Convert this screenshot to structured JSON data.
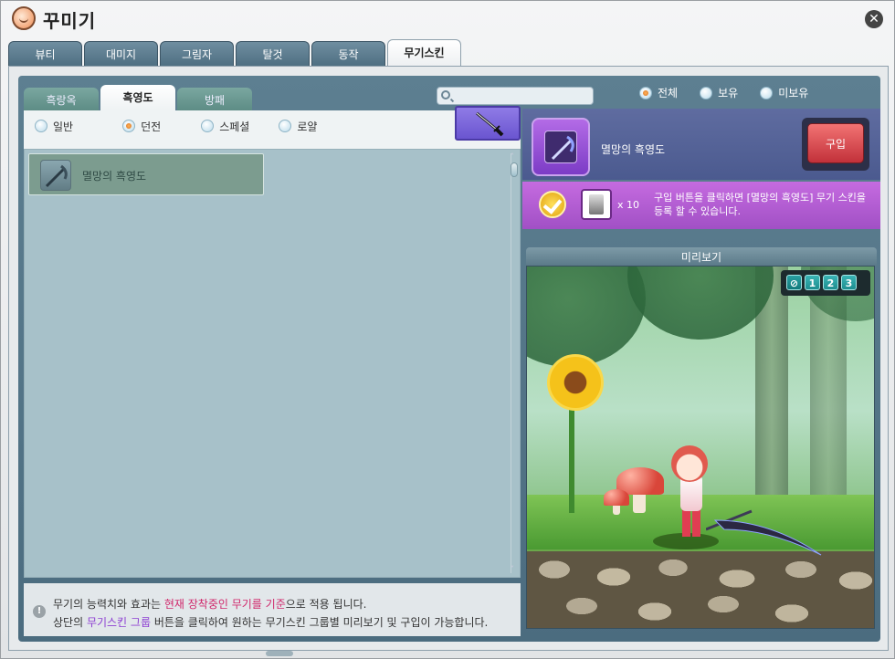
{
  "window": {
    "title": "꾸미기"
  },
  "main_tabs": [
    {
      "label": "뷰티",
      "active": false
    },
    {
      "label": "대미지",
      "active": false
    },
    {
      "label": "그림자",
      "active": false
    },
    {
      "label": "탈것",
      "active": false
    },
    {
      "label": "동작",
      "active": false
    },
    {
      "label": "무기스킨",
      "active": true
    }
  ],
  "sub_tabs": [
    {
      "label": "흑랑옥",
      "active": false
    },
    {
      "label": "흑영도",
      "active": true
    },
    {
      "label": "방패",
      "active": false
    }
  ],
  "search": {
    "placeholder": "",
    "value": ""
  },
  "ownership_filters": [
    {
      "label": "전체",
      "selected": true
    },
    {
      "label": "보유",
      "selected": false
    },
    {
      "label": "미보유",
      "selected": false
    }
  ],
  "type_filters": [
    {
      "label": "일반",
      "selected": false
    },
    {
      "label": "던전",
      "selected": true
    },
    {
      "label": "스페셜",
      "selected": false
    },
    {
      "label": "로얄",
      "selected": false
    }
  ],
  "skin_list": [
    {
      "name": "멸망의 흑영도"
    }
  ],
  "selected_skin": {
    "name": "멸망의 흑영도",
    "buy_label": "구입",
    "cost_count": "x 10",
    "cost_description": "구입 버튼을 클릭하면 [멸망의 흑영도] 무기 스킨을 등록 할 수 있습니다."
  },
  "preview": {
    "title": "미리보기",
    "view_buttons": [
      "",
      "1",
      "2",
      "3"
    ]
  },
  "notice": {
    "line1_pre": "무기의 능력치와 효과는 ",
    "line1_highlight": "현재 장착중인 무기를 기준",
    "line1_post": "으로 적용 됩니다.",
    "line2_pre": "상단의 ",
    "line2_highlight": "무기스킨 그룹",
    "line2_post": " 버튼을 클릭하여 원하는 무기스킨 그룹별 미리보기 및 구입이 가능합니다."
  },
  "colors": {
    "accent_purple": "#a150c5",
    "buy_red": "#c2313a",
    "frame_blue": "#4b6c7f",
    "highlight_red": "#d0276b",
    "highlight_purple": "#8d3fd2"
  },
  "icons": {
    "app": "avatar-face-icon",
    "close": "close-icon",
    "search": "search-icon",
    "weapon_group": "katana-icon",
    "check": "check-badge-icon",
    "coupon": "coupon-icon",
    "notice": "exclamation-icon",
    "hide_weapon": "no-icon"
  }
}
